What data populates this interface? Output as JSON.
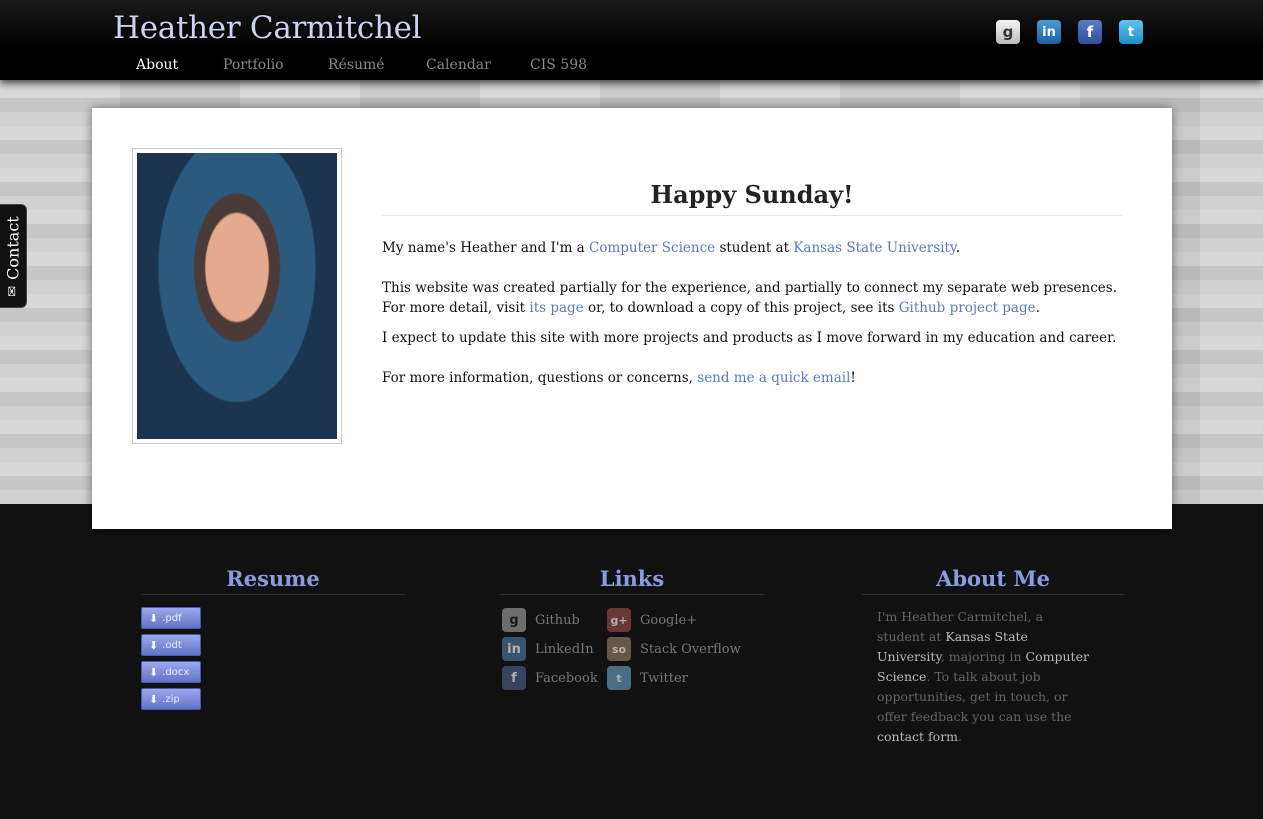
{
  "header": {
    "title": "Heather Carmitchel",
    "nav": [
      "About",
      "Portfolio",
      "Résumé",
      "Calendar",
      "CIS 598"
    ],
    "active_nav": "About",
    "social_icons": [
      {
        "name": "google",
        "glyph": "g"
      },
      {
        "name": "linkedin",
        "glyph": "in"
      },
      {
        "name": "facebook",
        "glyph": "f"
      },
      {
        "name": "twitter",
        "glyph": "t"
      }
    ]
  },
  "contact_tab": {
    "label": "Contact",
    "icon": "mail-icon"
  },
  "main": {
    "greeting": "Happy Sunday!",
    "p1": {
      "t1": "My name's Heather and I'm a ",
      "link1": "Computer Science",
      "t2": " student at ",
      "link2": "Kansas State University",
      "t3": "."
    },
    "p2": {
      "t1": "This website was created partially for the experience, and partially to connect my separate web presences. For more detail, visit ",
      "link1": "its page",
      "t2": " or, to download a copy of this project, see its ",
      "link2": "Github project page",
      "t3": "."
    },
    "p3": "I expect to update this site with more projects and products as I move forward in my education and career.",
    "p4": {
      "t1": "For more information, questions or concerns, ",
      "link1": "send me a quick email",
      "t2": "!"
    }
  },
  "footer": {
    "resume": {
      "heading": "Resume",
      "downloads": [
        ".pdf",
        ".odt",
        ".docx",
        ".zip"
      ]
    },
    "links": {
      "heading": "Links",
      "items": [
        {
          "label": "Github",
          "glyph": "g"
        },
        {
          "label": "LinkedIn",
          "glyph": "in"
        },
        {
          "label": "Facebook",
          "glyph": "f"
        },
        {
          "label": "Google+",
          "glyph": "g+"
        },
        {
          "label": "Stack Overflow",
          "glyph": "so"
        },
        {
          "label": "Twitter",
          "glyph": "t"
        }
      ]
    },
    "about": {
      "heading": "About Me",
      "t1": "I'm Heather Carmitchel, a student at ",
      "hl1": "Kansas State University",
      "t2": ", majoring in ",
      "hl2": "Computer Science",
      "t3": ". To talk about job opportunities, get in touch, or offer feedback you can use the ",
      "hl3": "contact form",
      "t4": "."
    }
  },
  "colors": {
    "accent": "#5b78c2",
    "footer_heading": "#8a9ce0",
    "header_title": "#ccd2f0"
  }
}
